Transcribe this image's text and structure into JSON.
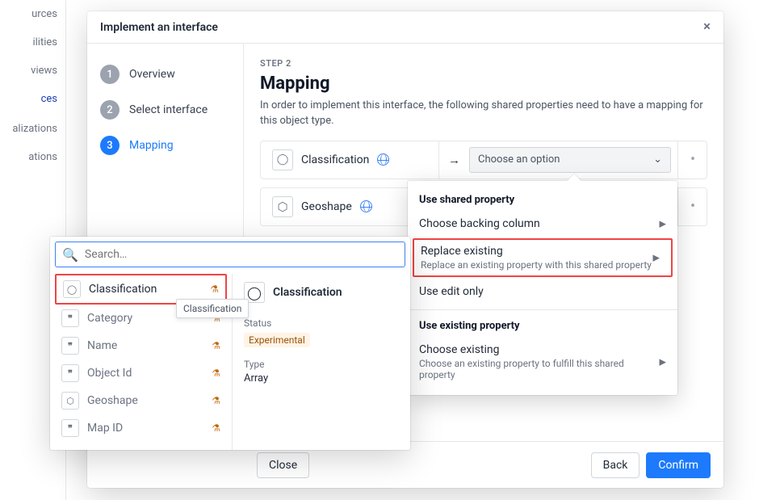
{
  "under_nav": [
    "urces",
    "ilities",
    "views",
    "ces",
    "alizations",
    "ations"
  ],
  "modal": {
    "title": "Implement an interface",
    "steps": [
      "Overview",
      "Select interface",
      "Mapping"
    ],
    "active_step_index": 2,
    "step_label": "STEP 2",
    "heading": "Mapping",
    "description": "In order to implement this interface, the following shared properties need to have a mapping for this object type.",
    "rows": [
      {
        "name": "Classification",
        "icon": "shield"
      },
      {
        "name": "Geoshape",
        "icon": "polygon"
      }
    ],
    "select_placeholder": "Choose an option",
    "footer": {
      "close": "Close",
      "back": "Back",
      "confirm": "Confirm"
    }
  },
  "dropdown": {
    "section1": "Use shared property",
    "opt1": {
      "title": "Choose backing column"
    },
    "opt2": {
      "title": "Replace existing",
      "desc": "Replace an existing property with this shared property"
    },
    "opt3": {
      "title": "Use edit only"
    },
    "section2": "Use existing property",
    "opt4": {
      "title": "Choose existing",
      "desc": "Choose an existing property to fulfill this shared property"
    }
  },
  "popover": {
    "search_placeholder": "Search…",
    "items": [
      {
        "name": "Classification",
        "icon": "shield",
        "selected": true
      },
      {
        "name": "Category",
        "icon": "quote"
      },
      {
        "name": "Name",
        "icon": "quote"
      },
      {
        "name": "Object Id",
        "icon": "quote"
      },
      {
        "name": "Geoshape",
        "icon": "polygon"
      },
      {
        "name": "Map ID",
        "icon": "quote"
      }
    ],
    "tooltip": "Classification",
    "detail": {
      "name": "Classification",
      "status_label": "Status",
      "status_value": "Experimental",
      "type_label": "Type",
      "type_value": "Array"
    }
  }
}
